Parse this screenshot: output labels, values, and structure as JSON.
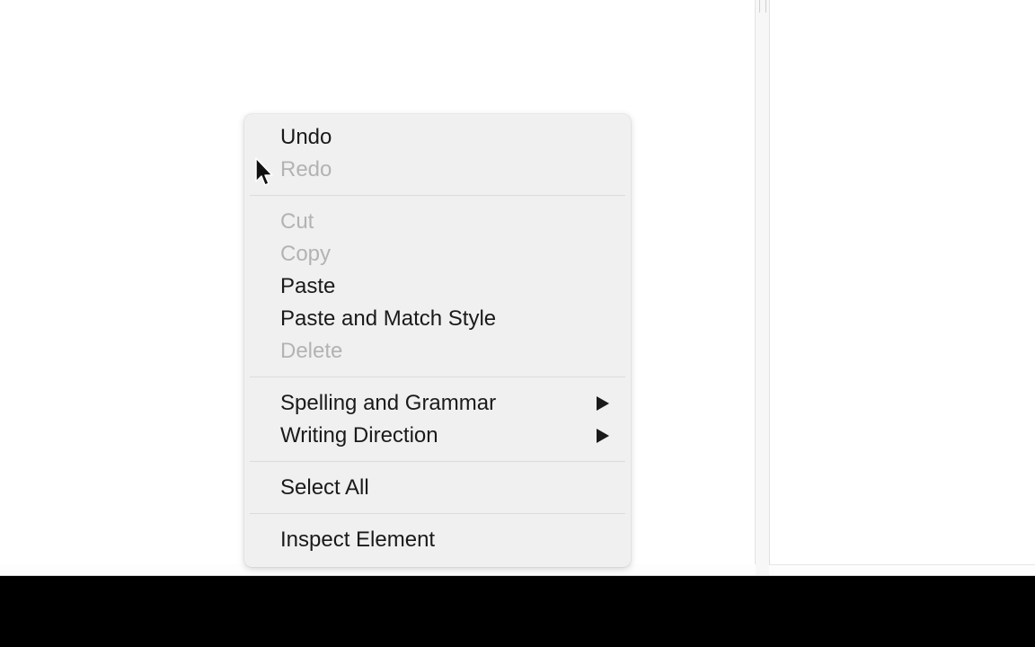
{
  "context_menu": {
    "items": [
      {
        "label": "Undo",
        "enabled": true
      },
      {
        "label": "Redo",
        "enabled": false
      },
      {
        "label": "Cut",
        "enabled": false
      },
      {
        "label": "Copy",
        "enabled": false
      },
      {
        "label": "Paste",
        "enabled": true
      },
      {
        "label": "Paste and Match Style",
        "enabled": true
      },
      {
        "label": "Delete",
        "enabled": false
      },
      {
        "label": "Spelling and Grammar",
        "enabled": true,
        "submenu": true
      },
      {
        "label": "Writing Direction",
        "enabled": true,
        "submenu": true
      },
      {
        "label": "Select All",
        "enabled": true
      },
      {
        "label": "Inspect Element",
        "enabled": true
      }
    ]
  },
  "colors": {
    "menu_background": "#f0f0f0",
    "enabled_text": "#1a1a1a",
    "disabled_text": "#b3b3b3",
    "separator": "#dcdcdc"
  },
  "icons": {
    "cursor": "arrow-cursor-icon",
    "submenu": "triangle-right-icon"
  }
}
